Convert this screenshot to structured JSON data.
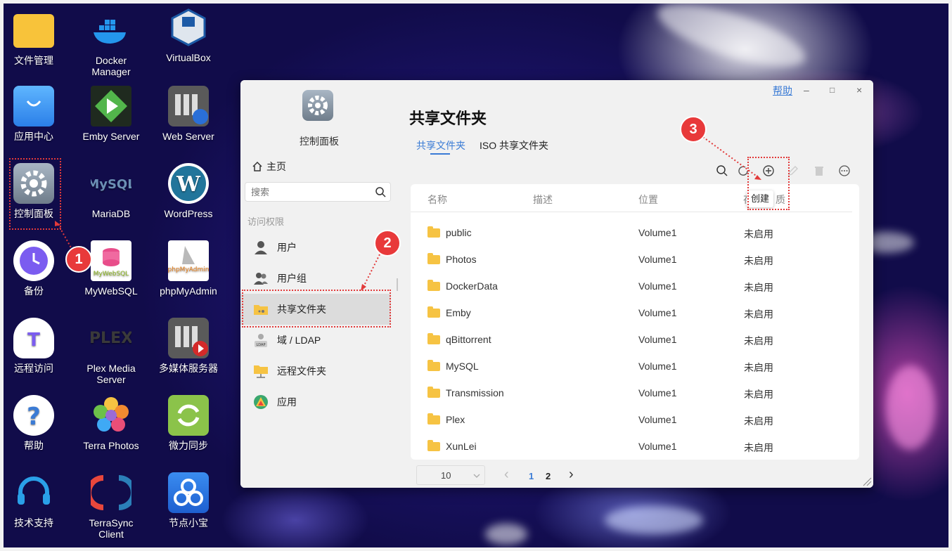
{
  "desktop": {
    "icons": [
      {
        "label": "文件管理",
        "icon": "folder-icon"
      },
      {
        "label": "Docker Manager",
        "icon": "docker-icon"
      },
      {
        "label": "VirtualBox",
        "icon": "virtualbox-icon"
      },
      {
        "label": "应用中心",
        "icon": "app-center-icon"
      },
      {
        "label": "Emby Server",
        "icon": "emby-icon"
      },
      {
        "label": "Web Server",
        "icon": "web-server-icon"
      },
      {
        "label": "控制面板",
        "icon": "control-panel-icon"
      },
      {
        "label": "MariaDB",
        "icon": "mysql-icon"
      },
      {
        "label": "WordPress",
        "icon": "wordpress-icon"
      },
      {
        "label": "备份",
        "icon": "backup-icon"
      },
      {
        "label": "MyWebSQL",
        "icon": "mywebsql-icon"
      },
      {
        "label": "phpMyAdmin",
        "icon": "phpmyadmin-icon"
      },
      {
        "label": "远程访问",
        "icon": "remote-access-icon"
      },
      {
        "label": "Plex Media Server",
        "icon": "plex-icon"
      },
      {
        "label": "多媒体服务器",
        "icon": "media-server-icon"
      },
      {
        "label": "帮助",
        "icon": "help-icon"
      },
      {
        "label": "Terra Photos",
        "icon": "terra-photos-icon"
      },
      {
        "label": "微力同步",
        "icon": "sync-icon"
      },
      {
        "label": "技术支持",
        "icon": "support-headset-icon"
      },
      {
        "label": "TerraSync Client",
        "icon": "terrasync-icon"
      },
      {
        "label": "节点小宝",
        "icon": "node-icon"
      }
    ],
    "mywebsql_art_text": "MyWebSQL",
    "phpmyadmin_art_text": "phpMyAdmin",
    "mysql_art_text": "MySQL",
    "plex_art_text": "PLEX"
  },
  "window": {
    "help_link": "帮助",
    "minimize": "–",
    "maximize": "□",
    "close": "×",
    "sidebar": {
      "app_title": "控制面板",
      "home": "主页",
      "search_placeholder": "搜索",
      "section": "访问权限",
      "items": [
        "用户",
        "用户组",
        "共享文件夹",
        "域 / LDAP",
        "远程文件夹",
        "应用"
      ],
      "selected": "共享文件夹"
    },
    "title": "共享文件夹",
    "tabs": [
      "共享文件夹",
      "ISO 共享文件夹"
    ],
    "active_tab": "共享文件夹",
    "toolbar": {
      "tooltip": "创建"
    },
    "columns": [
      "名称",
      "描述",
      "位置",
      "存储空间"
    ],
    "column_overlap": "存",
    "column_overlap_tail": "质",
    "rows": [
      {
        "name": "public",
        "desc": "",
        "location": "Volume1",
        "status": "未启用"
      },
      {
        "name": "Photos",
        "desc": "",
        "location": "Volume1",
        "status": "未启用"
      },
      {
        "name": "DockerData",
        "desc": "",
        "location": "Volume1",
        "status": "未启用"
      },
      {
        "name": "Emby",
        "desc": "",
        "location": "Volume1",
        "status": "未启用"
      },
      {
        "name": "qBittorrent",
        "desc": "",
        "location": "Volume1",
        "status": "未启用"
      },
      {
        "name": "MySQL",
        "desc": "",
        "location": "Volume1",
        "status": "未启用"
      },
      {
        "name": "Transmission",
        "desc": "",
        "location": "Volume1",
        "status": "未启用"
      },
      {
        "name": "Plex",
        "desc": "",
        "location": "Volume1",
        "status": "未启用"
      },
      {
        "name": "XunLei",
        "desc": "",
        "location": "Volume1",
        "status": "未启用"
      }
    ],
    "pagination": {
      "page_size": "10",
      "pages": [
        "1",
        "2"
      ],
      "current": "1",
      "prev": "‹",
      "next": "›"
    }
  },
  "annotations": {
    "badges": [
      "1",
      "2",
      "3"
    ],
    "color": "#e8393a"
  },
  "colors": {
    "accent": "#3a7bd5",
    "folder": "#f6c343"
  }
}
